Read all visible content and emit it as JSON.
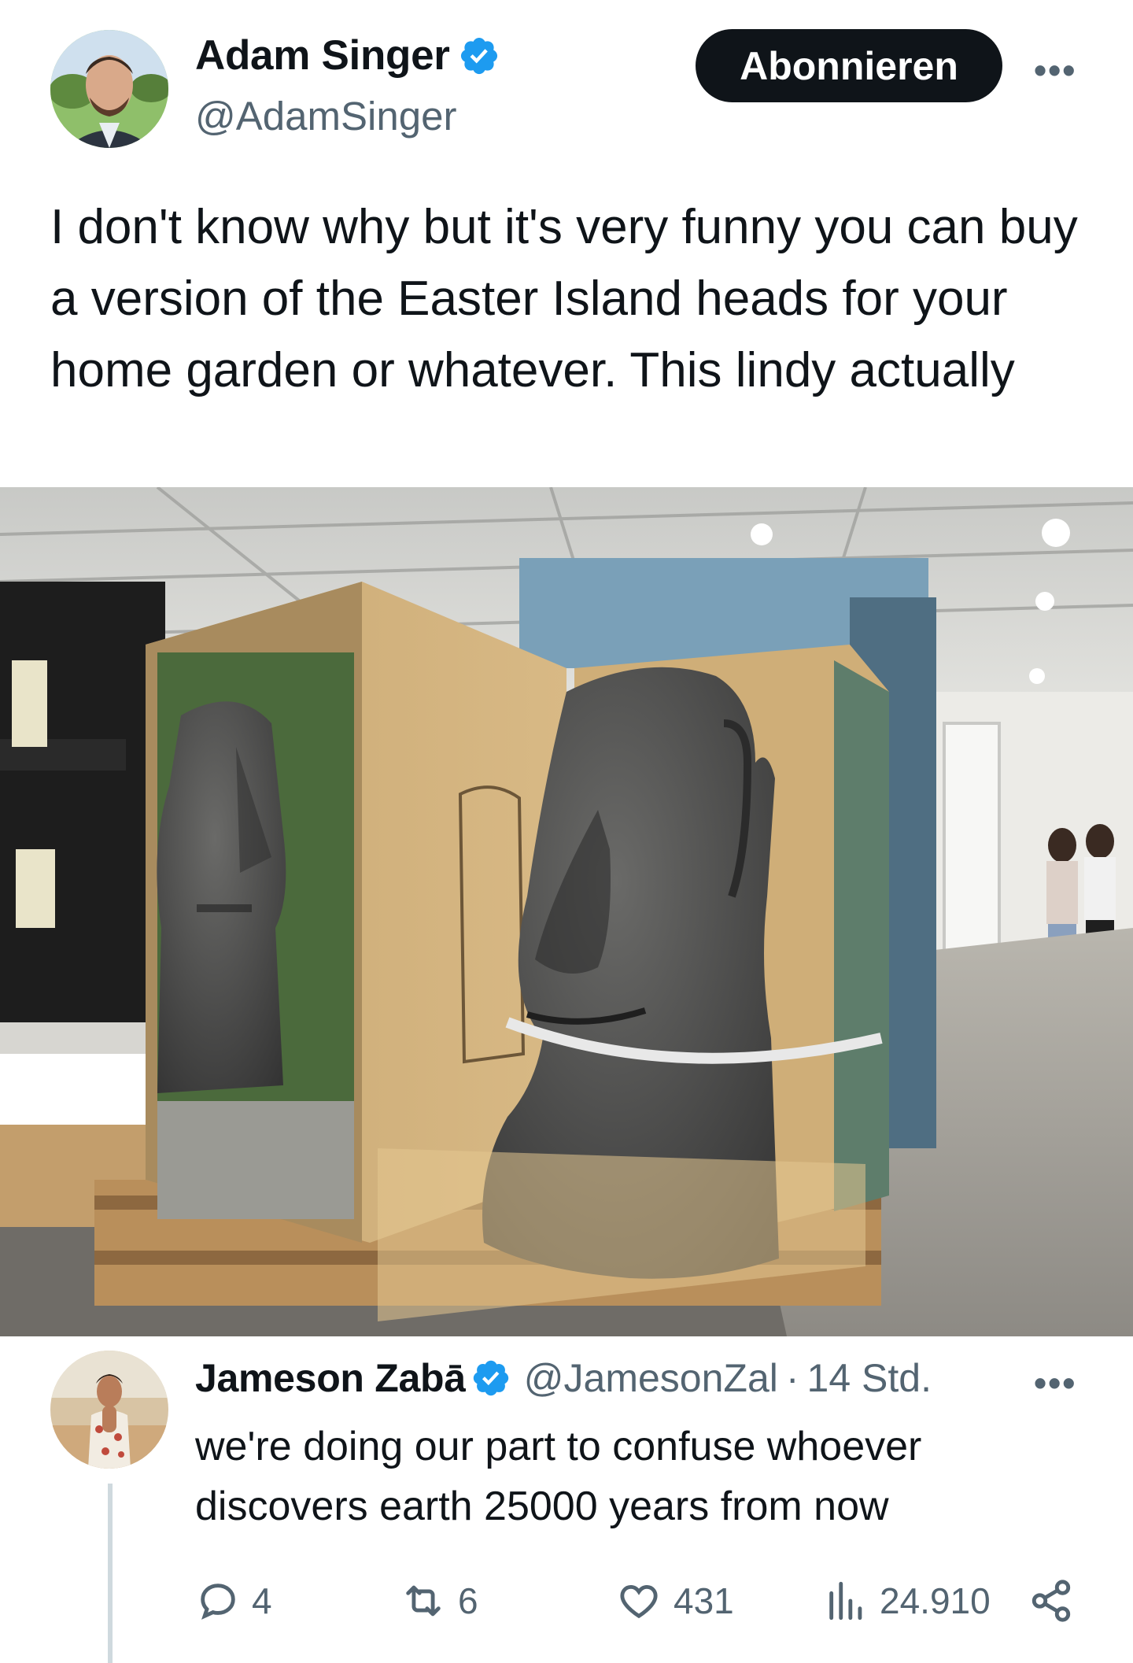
{
  "post": {
    "author_name": "Adam Singer",
    "author_handle": "@AdamSinger",
    "follow_label": "Abonnieren",
    "more_label": "•••",
    "text": "I don't know why but it's very funny you can buy a version of the Easter Island heads for your home garden or whatever. This lindy actually",
    "image_icon": "photo-of-moai-statues"
  },
  "reply": {
    "author_name": "Jameson Zabā",
    "author_handle": "@JamesonZal",
    "separator": "·",
    "timestamp": "14 Std.",
    "more_label": "•••",
    "text": "we're doing our part to confuse whoever discovers earth 25000 years from now",
    "actions": {
      "replies": "4",
      "reposts": "6",
      "likes": "431",
      "views": "24.910"
    }
  },
  "colors": {
    "verified": "#1d9bf0",
    "follow_bg": "#0f1419",
    "secondary_text": "#536471"
  }
}
